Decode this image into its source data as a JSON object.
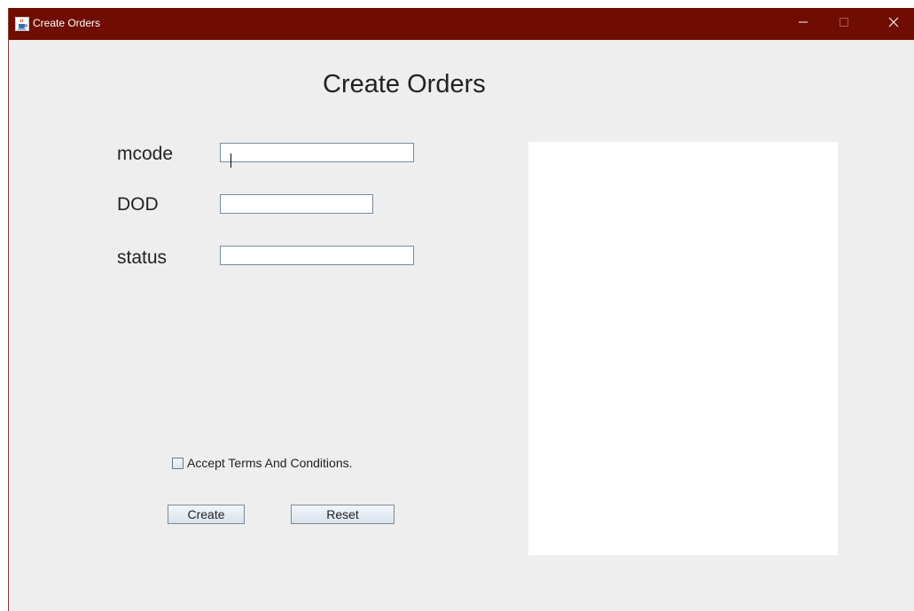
{
  "window": {
    "title": "Create Orders",
    "title_bar_color": "#6f0d02",
    "background": "#eeeeee"
  },
  "form": {
    "heading": "Create Orders",
    "fields": [
      {
        "label": "mcode",
        "value": ""
      },
      {
        "label": "DOD",
        "value": ""
      },
      {
        "label": "status",
        "value": ""
      }
    ],
    "terms_checkbox": {
      "label": "Accept Terms And Conditions.",
      "checked": false
    },
    "create_label": "Create",
    "reset_label": "Reset"
  },
  "icons": {
    "app": "java-coffee-icon",
    "minimize": "minimize-icon",
    "maximize": "maximize-icon",
    "close": "close-icon"
  }
}
